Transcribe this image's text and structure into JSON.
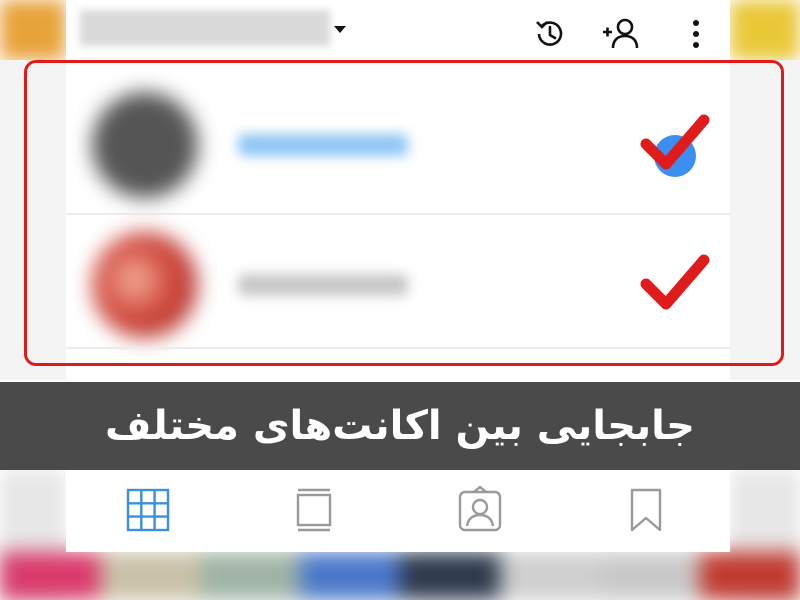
{
  "caption": {
    "text": "جابجایی بین اکانت‌های مختلف"
  },
  "topbar": {
    "icons": [
      "chevron-down-icon",
      "archive-icon",
      "discover-people-icon",
      "more-options-icon"
    ]
  },
  "accounts": [
    {
      "selected": true,
      "avatar": "blurred",
      "name": "blurred"
    },
    {
      "selected": false,
      "avatar": "blurred",
      "name": "blurred"
    }
  ],
  "profile_tabs": {
    "active": "grid",
    "icons": [
      "grid-icon",
      "feed-icon",
      "tagged-icon",
      "saved-icon"
    ]
  },
  "colors": {
    "highlight_frame": "#e01b1b",
    "check_mark": "#e01b1b",
    "selected_dot": "#3c8ff0",
    "banner_bg": "#4a4a4a",
    "caption_text": "#ffffff",
    "active_tab": "#3b8fe0",
    "inactive_tab": "#9a9a9a"
  }
}
